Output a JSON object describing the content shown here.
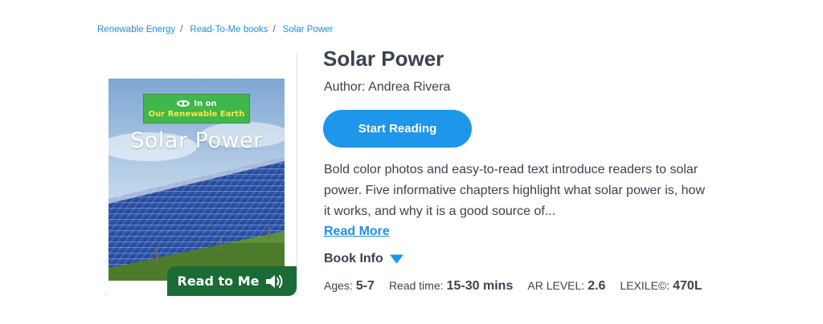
{
  "breadcrumb": [
    "Renewable Energy",
    "Read-To-Me books",
    "Solar Power"
  ],
  "breadcrumb_separator": "/",
  "cover": {
    "series_line1": "In on",
    "series_line2": "Our Renewable Earth",
    "title": "Solar Power",
    "author": "Andrea Rivera"
  },
  "read_to_me": {
    "label": "Read to Me",
    "icon": "speaker-icon"
  },
  "book": {
    "title": "Solar Power",
    "author_line": "Author: Andrea Rivera",
    "start_button": "Start Reading",
    "description": "Bold color photos and easy-to-read text introduce readers to solar power. Five informative chapters highlight what solar power is, how it works, and why it is a good source of...",
    "read_more": "Read More",
    "book_info_label": "Book Info",
    "book_info_icon": "caret-down-icon"
  },
  "meta": {
    "ages_label": "Ages:",
    "ages_value": "5-7",
    "readtime_label": "Read time:",
    "readtime_value": "15-30 mins",
    "ar_label": "AR LEVEL:",
    "ar_value": "2.6",
    "lexile_label": "LEXILE©:",
    "lexile_value": "470L"
  },
  "colors": {
    "accent_blue": "#1e96ea",
    "text_dark": "#3a4350",
    "read_to_me_green": "#1a6b36",
    "series_badge_green": "#3fb74a"
  }
}
